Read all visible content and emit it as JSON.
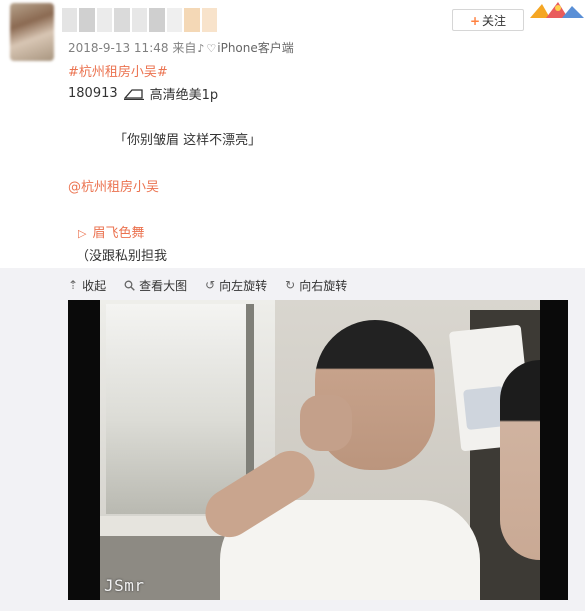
{
  "post": {
    "follow_label": "关注",
    "follow_plus": "+",
    "timestamp": "2018-9-13 11:48",
    "source_prefix": "来自",
    "source_client": "iPhone客户端",
    "hashtag": "#杭州租房小吴#",
    "line1_code": "180913",
    "line1_text": "高清绝美1p",
    "quote": "「你别皱眉 这样不漂亮」",
    "mention": "@杭州租房小吴",
    "music_label": "眉飞色舞",
    "tail": "（没跟私别担我"
  },
  "toolbar": {
    "collapse": "收起",
    "view_large": "查看大图",
    "rotate_left": "向左旋转",
    "rotate_right": "向右旋转"
  },
  "photo": {
    "watermark": "JSmr"
  },
  "icons": {
    "collapse": "arrow-up-icon",
    "view_large": "magnifier-icon",
    "rotate_left": "rotate-left-icon",
    "rotate_right": "rotate-right-icon",
    "music": "play-triangle-icon",
    "line1": "train-icon"
  },
  "colors": {
    "accent": "#eb7350",
    "follow_plus": "#ff8140",
    "panel_bg": "#f2f2f5"
  }
}
